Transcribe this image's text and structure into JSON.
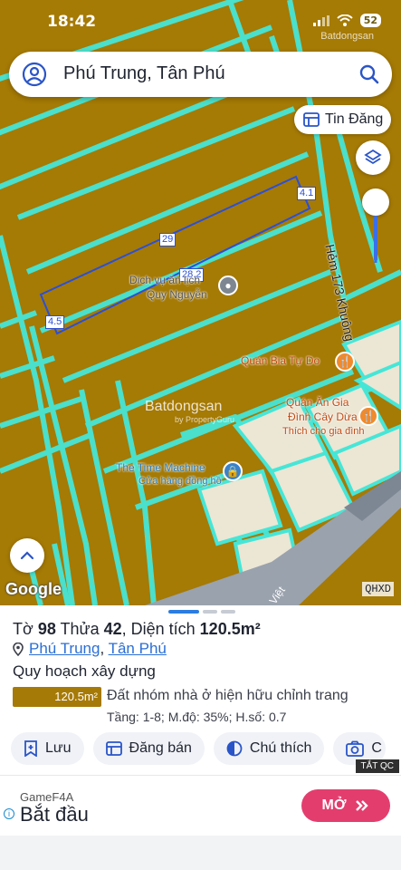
{
  "status_bar": {
    "time": "18:42",
    "battery": "52"
  },
  "watermark": "Batdongsan",
  "search": {
    "query": "Phú Trung, Tân Phú"
  },
  "map": {
    "tin_dang_label": "Tin Đăng",
    "street_label": "Hẻm 173 Khuông",
    "measurements": [
      "4.1",
      "29",
      "28.2",
      "4.5"
    ],
    "pois": [
      {
        "name": "Dịch vụ ăn lịch",
        "sub": "Quy Nguyễn"
      },
      {
        "name": "Quán Bia Tự Do",
        "sub": ""
      },
      {
        "name": "Quán Ăn Gia",
        "sub": "Đình Cây Dừa"
      },
      {
        "name": "",
        "sub": "Thích cho gia đình"
      },
      {
        "name": "The Time Machine",
        "sub": "Cửa hàng đồng hồ"
      }
    ],
    "watermark_center": "Batdongsan",
    "watermark_center_sub": "by PropertyGuru",
    "google": "Google",
    "road_label": "Việt",
    "qhxd": "QHXD",
    "colors": {
      "parcel_fill": "#a57a05",
      "boundary": "#46e6d7",
      "accent": "#2b4fd8"
    }
  },
  "sheet": {
    "parcel": {
      "prefix": "Tờ ",
      "to": "98",
      "thua_label": " Thửa ",
      "thua": "42",
      "area_label": ", Diện tích ",
      "area": "120.5m²"
    },
    "location": {
      "ward": "Phú Trung",
      "sep": ", ",
      "district": "Tân Phú"
    },
    "section_title": "Quy hoạch xây dựng",
    "zone": {
      "area": "120.5m²",
      "desc": "Đất nhóm nhà ở hiện hữu chỉnh trang",
      "meta": "Tầng: 1-8; M.độ: 35%; H.số: 0.7"
    },
    "actions": [
      {
        "label": "Lưu",
        "icon": "bookmark-plus-icon"
      },
      {
        "label": "Đăng bán",
        "icon": "listing-icon"
      },
      {
        "label": "Chú thích",
        "icon": "legend-icon"
      },
      {
        "label": "C",
        "icon": "camera-icon"
      }
    ]
  },
  "ad": {
    "close": "TẮT QC",
    "brand": "GameF4A",
    "title": "Bắt đầu",
    "cta": "MỞ",
    "cta_icon": "double-chevron-right-icon",
    "info_icon": "info-icon"
  }
}
